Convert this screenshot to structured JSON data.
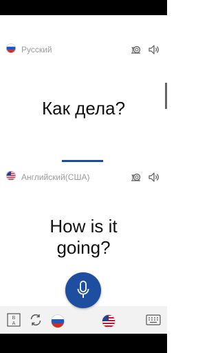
{
  "source": {
    "language": "Русский",
    "text": "Как дела?",
    "flag": "russia-flag-icon"
  },
  "target": {
    "language": "Английский(США)",
    "text_line1": "How is it",
    "text_line2": "going?",
    "flag": "usa-flag-icon"
  },
  "toolbar": {
    "buttons": [
      "swap-text-direction-icon",
      "refresh-icon",
      "russia-flag-icon",
      "microphone-icon",
      "usa-flag-icon",
      "keyboard-icon"
    ]
  },
  "colors": {
    "accent": "#1d4ea0",
    "muted_text": "#9a9a9a"
  }
}
